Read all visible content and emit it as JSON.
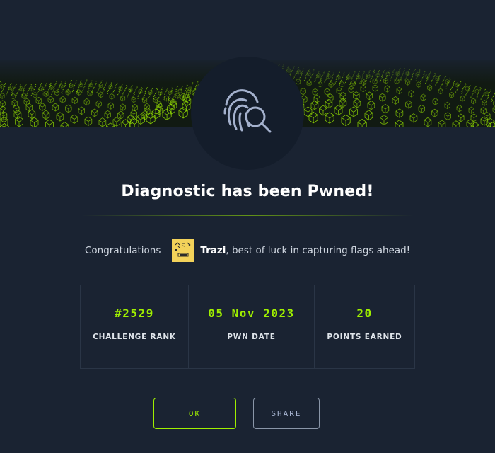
{
  "modal": {
    "title": "Diagnostic has been Pwned!",
    "badge_icon": "fingerprint-search-icon",
    "congrats_prefix": "Congratulations",
    "username": "Trazi",
    "congrats_suffix": ", best of luck in capturing flags ahead!"
  },
  "stats": [
    {
      "value": "#2529",
      "label": "CHALLENGE RANK"
    },
    {
      "value": "05 Nov 2023",
      "label": "PWN DATE"
    },
    {
      "value": "20",
      "label": "POINTS EARNED"
    }
  ],
  "buttons": {
    "ok": "OK",
    "share": "SHARE"
  },
  "colors": {
    "background": "#1a2332",
    "accent": "#9fef00",
    "panel": "#141d2b"
  }
}
